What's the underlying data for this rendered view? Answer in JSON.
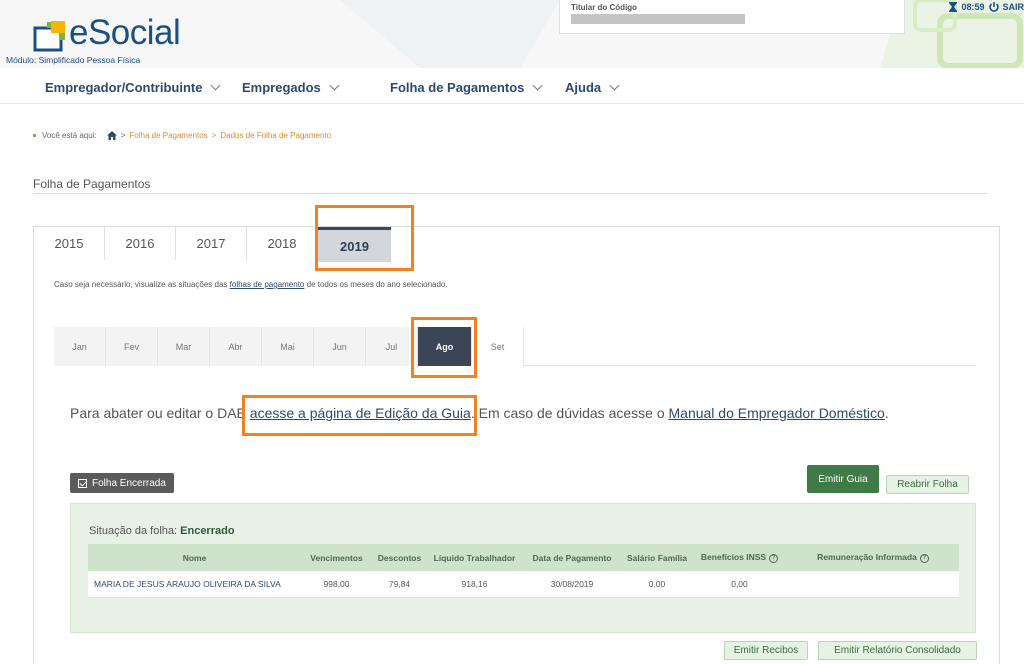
{
  "header": {
    "logo_text": "eSocial",
    "modulo": "Módulo: Simplificado Pessoa Física",
    "titular_label": "Titular do Código",
    "time": "08:59",
    "sair": "SAIR"
  },
  "nav": {
    "items": [
      {
        "label": "Empregador/Contribuinte"
      },
      {
        "label": "Empregados"
      },
      {
        "label": "Folha de Pagamentos"
      },
      {
        "label": "Ajuda"
      }
    ]
  },
  "breadcrumb": {
    "prefix": "Você está aqui:",
    "sep1": ">",
    "crumb1": "Folha de Pagamentos",
    "sep2": ">",
    "crumb2": "Dados de Folha de Pagamento"
  },
  "page_title": "Folha de Pagamentos",
  "year_tabs": [
    "2015",
    "2016",
    "2017",
    "2018",
    "2019"
  ],
  "year_active": "2019",
  "year_note": {
    "before": "Caso seja necessário, visualize as situações das ",
    "link": "folhas de pagamento",
    "after": " de todos os meses do ano selecionado."
  },
  "month_tabs": [
    "Jan",
    "Fev",
    "Mar",
    "Abr",
    "Mai",
    "Jun",
    "Jul",
    "Ago",
    "Set"
  ],
  "month_active": "Ago",
  "dae_msg": {
    "before": "Para abater ou editar o DAE ",
    "link1": "acesse a página de Edição da Guia",
    "middle": ". Em caso de dúvidas acesse o ",
    "link2": "Manual do Empregador Doméstico",
    "after": "."
  },
  "status_badge": "Folha Encerrada",
  "buttons": {
    "emitir_guia": "Emitir Guia",
    "reabrir_folha": "Reabrir Folha",
    "emitir_recibos": "Emitir Recibos",
    "emitir_relatorio": "Emitir Relatório Consolidado"
  },
  "situacao": {
    "label": "Situação da folha:",
    "value": "Encerrado"
  },
  "table": {
    "columns": [
      "Nome",
      "Vencimentos",
      "Descontos",
      "Líquido Trabalhador",
      "Data de Pagamento",
      "Salário Família",
      "Benefícios INSS",
      "Remuneração Informada"
    ],
    "help_mark": "?",
    "rows": [
      [
        "MARIA DE JESUS ARAUJO OLIVEIRA DA SILVA",
        "998,00",
        "79,84",
        "918,16",
        "30/08/2019",
        "0,00",
        "0,00",
        ""
      ]
    ]
  },
  "colors": {
    "accent_green": "#3e7b47",
    "highlight_orange": "#f0831f",
    "active_month": "#3b4556",
    "brand_blue": "#1a4f86"
  }
}
